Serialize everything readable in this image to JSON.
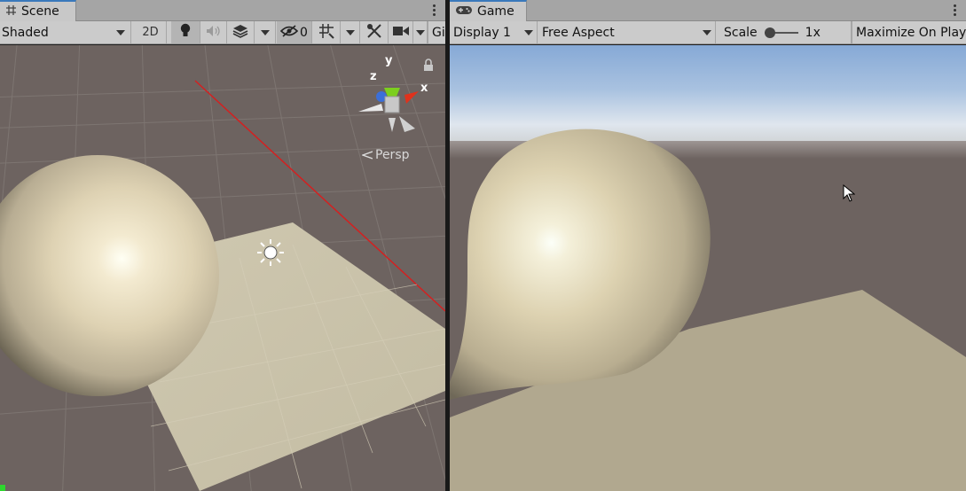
{
  "scene": {
    "tab_label": "Scene",
    "tab_icon": "grid-hash-icon",
    "shading_mode": "Shaded",
    "toggle_2d": "2D",
    "hidden_count": "0",
    "gizmos_label": "Gi",
    "persp_label": "Persp",
    "axis_y": "y",
    "axis_x": "x",
    "axis_z": "z",
    "icons": [
      "lighting-bulb-icon",
      "audio-speaker-icon",
      "effects-layers-icon",
      "visibility-eye-slash-icon",
      "grid-snap-icon",
      "tools-icon",
      "camera-icon"
    ]
  },
  "game": {
    "tab_label": "Game",
    "tab_icon": "gamepad-icon",
    "display": "Display 1",
    "aspect": "Free Aspect",
    "scale_label": "Scale",
    "scale_value": "1x",
    "scale_fraction": 0.0,
    "maximize_label": "Maximize On Play"
  },
  "colors": {
    "tab_active_accent": "#3a79bb",
    "toolbar_bg": "#cbcbcb",
    "scene_bg": "#6d6360",
    "axis_x_red": "#e0321c",
    "axis_y_green": "#7ccf1e",
    "axis_z_blue": "#3b6fd8",
    "ground_plane": "#c9c2ab",
    "game_sky_top": "#8aaed8",
    "game_ground": "#6d6360"
  }
}
